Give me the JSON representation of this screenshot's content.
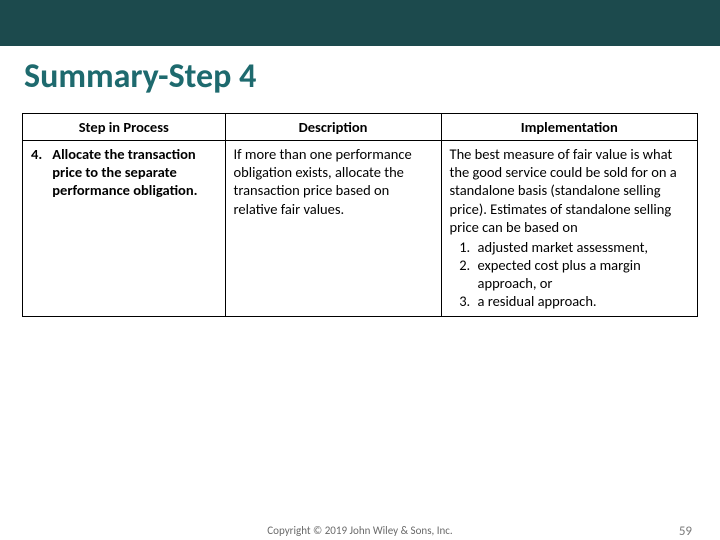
{
  "title": "Summary-Step 4",
  "headers": {
    "col1": "Step in Process",
    "col2": "Description",
    "col3": "Implementation"
  },
  "row": {
    "number": "4.",
    "step": "Allocate the transaction price to the separate performance obligation.",
    "description": "If more than one performance obligation exists, allocate the transaction price based on relative fair values.",
    "implementation_intro": "The best measure of fair value is what the good service could be sold for on a standalone basis (standalone selling price). Estimates of standalone selling price can be based on",
    "implementation_items": [
      "adjusted market assessment,",
      "expected cost plus a margin approach, or",
      "a residual approach."
    ]
  },
  "footer": {
    "copyright": "Copyright © 2019 John Wiley & Sons, Inc.",
    "page": "59"
  }
}
